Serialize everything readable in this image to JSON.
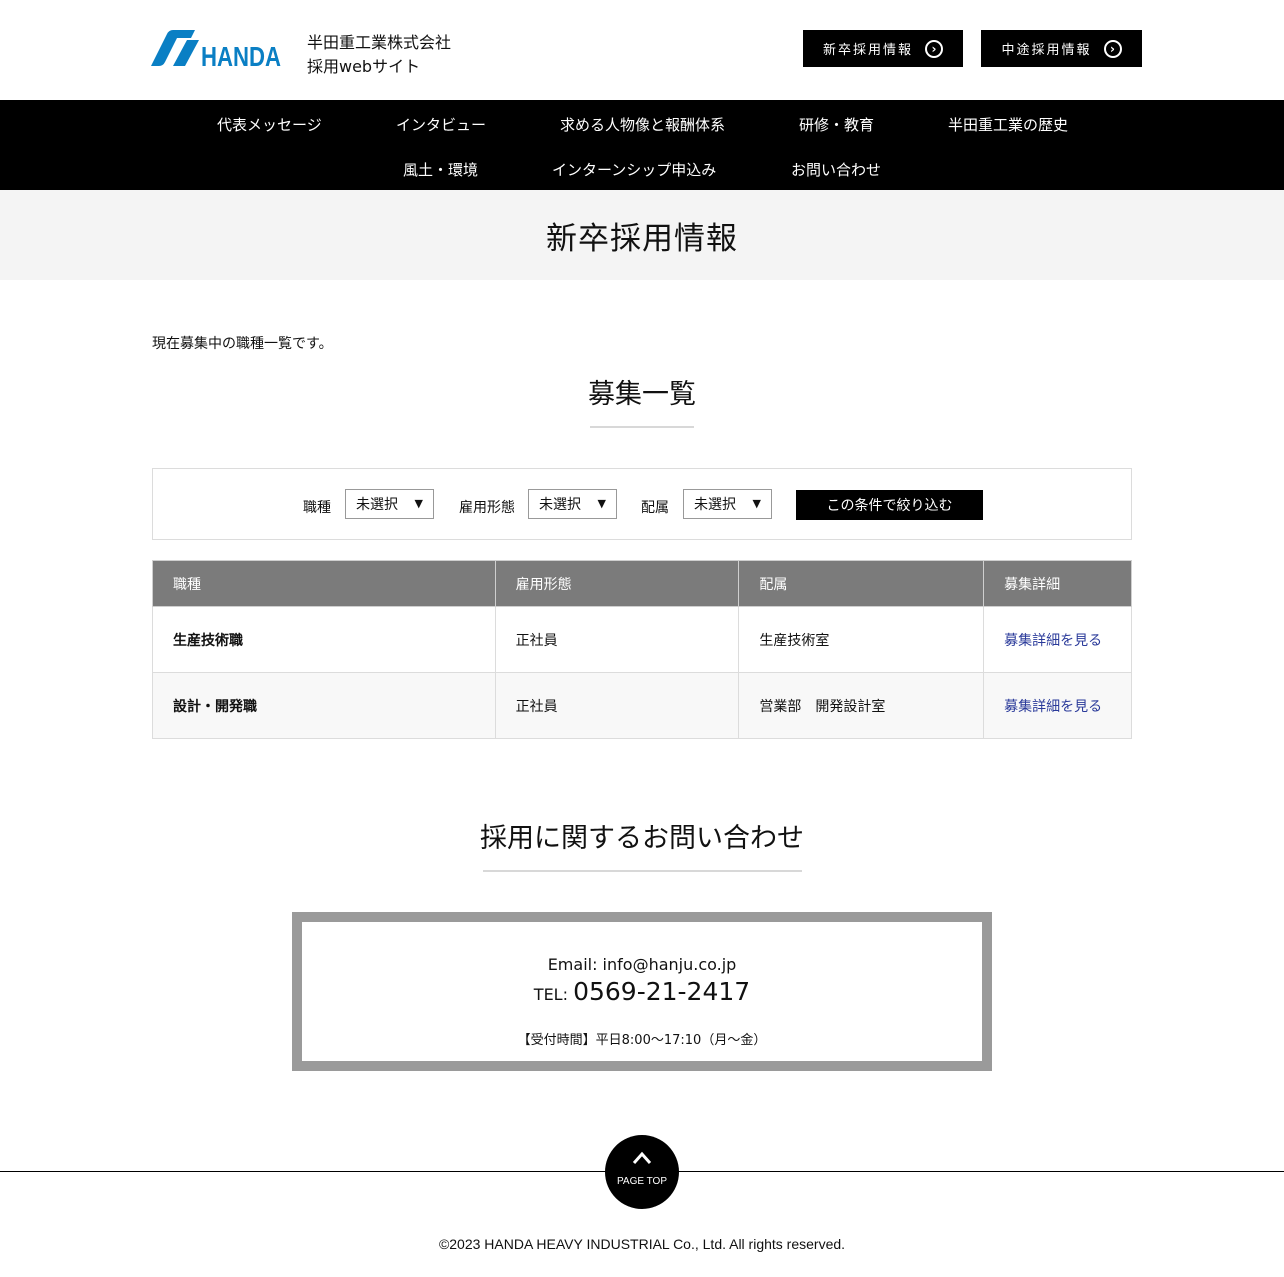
{
  "header": {
    "logo_text": "HANDA",
    "company_name": "半田重工業株式会社",
    "site_name": "採用webサイト",
    "btn_newgrad": "新卒採用情報",
    "btn_midcareer": "中途採用情報",
    "brand_color": "#0a7fc4"
  },
  "nav": {
    "items": [
      "代表メッセージ",
      "インタビュー",
      "求める人物像と報酬体系",
      "研修・教育",
      "半田重工業の歴史",
      "風土・環境",
      "インターンシップ申込み",
      "お問い合わせ"
    ]
  },
  "page": {
    "title": "新卒採用情報",
    "intro": "現在募集中の職種一覧です。",
    "list_title": "募集一覧"
  },
  "filter": {
    "label_job": "職種",
    "label_employment": "雇用形態",
    "label_department": "配属",
    "select_job": "未選択",
    "select_employment": "未選択",
    "select_department": "未選択",
    "submit": "この条件で絞り込む"
  },
  "table": {
    "headers": [
      "職種",
      "雇用形態",
      "配属",
      "募集詳細"
    ],
    "rows": [
      {
        "job": "生産技術職",
        "employment": "正社員",
        "department": "生産技術室",
        "link": "募集詳細を見る"
      },
      {
        "job": "設計・開発職",
        "employment": "正社員",
        "department": "営業部　開発設計室",
        "link": "募集詳細を見る"
      }
    ]
  },
  "contact": {
    "title": "採用に関するお問い合わせ",
    "email": "Email: info@hanju.co.jp",
    "tel_label": "TEL:",
    "tel_number": "0569-21-2417",
    "hours": "【受付時間】平日8:00～17:10（月～金）"
  },
  "footer": {
    "page_top": "PAGE TOP",
    "copyright": "©2023 HANDA HEAVY INDUSTRIAL Co., Ltd. All rights reserved."
  }
}
